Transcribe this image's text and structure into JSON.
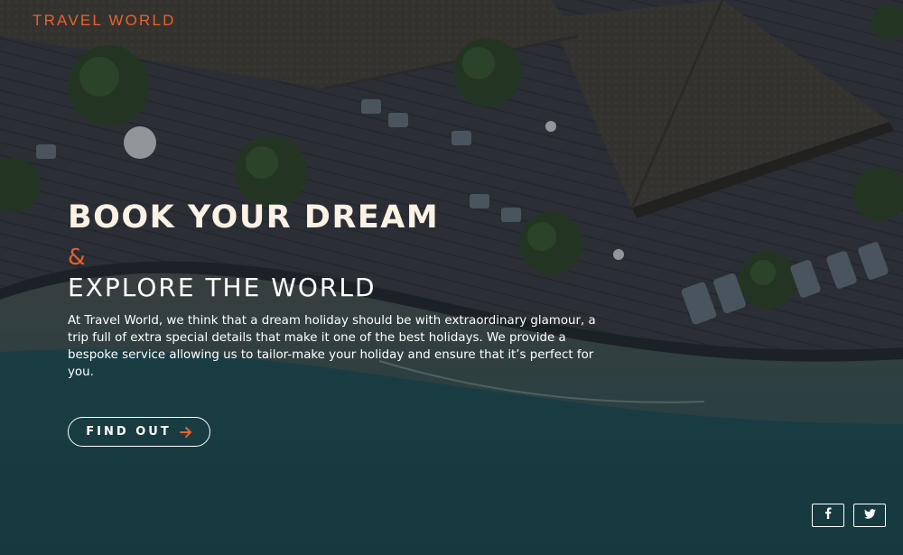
{
  "brand": {
    "name": "TRAVEL WORLD"
  },
  "hero": {
    "headline": "BOOK YOUR DREAM",
    "ampersand": "&",
    "subheadline": "EXPLORE THE WORLD",
    "description": "At Travel World, we think that a dream holiday should be with extraordinary glamour, a trip full of extra special details that make it one of the best holidays. We provide a bespoke service allowing us to tailor-make your holiday and ensure that it’s perfect for you.",
    "cta_label": "FIND OUT",
    "cta_icon": "arrow-right-icon"
  },
  "social": [
    {
      "name": "facebook",
      "icon": "facebook-icon"
    },
    {
      "name": "twitter",
      "icon": "twitter-icon"
    }
  ],
  "colors": {
    "accent": "#e8622c",
    "headline": "#fbf1e4",
    "text": "#ffffff",
    "sea": "#1f5a5e",
    "deck": "#3a3d44",
    "roof": "#4a4740"
  }
}
